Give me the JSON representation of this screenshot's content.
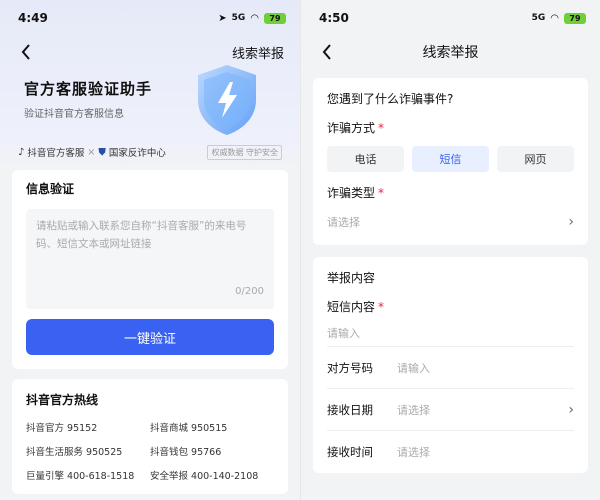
{
  "left": {
    "status": {
      "time": "4:49",
      "battery": "79",
      "signal": "5G"
    },
    "nav": {
      "right_label": "线索举报"
    },
    "hero": {
      "title": "官方客服验证助手",
      "subtitle": "验证抖音官方客服信息"
    },
    "trust": {
      "item1": "抖音官方客服",
      "sep": "×",
      "item2": "国家反诈中心",
      "tag": "权威数据 守护安全"
    },
    "verify": {
      "heading": "信息验证",
      "placeholder": "请粘贴或输入联系您自称“抖音客服”的来电号码、短信文本或网址链接",
      "counter": "0/200",
      "button": "一键验证"
    },
    "hotline": {
      "heading": "抖音官方热线",
      "items": [
        "抖音官方 95152",
        "抖音商城 950515",
        "抖音生活服务 950525",
        "抖音钱包 95766",
        "巨量引擎 400-618-1518",
        "安全举报 400-140-2108"
      ]
    }
  },
  "right": {
    "status": {
      "time": "4:50",
      "battery": "79",
      "signal": "5G"
    },
    "nav": {
      "title": "线索举报"
    },
    "question": "您遇到了什么诈骗事件?",
    "method": {
      "label": "诈骗方式",
      "required": "*",
      "options": [
        "电话",
        "短信",
        "网页"
      ],
      "selected": "短信"
    },
    "type": {
      "label": "诈骗类型",
      "required": "*",
      "placeholder": "请选择"
    },
    "report": {
      "heading": "举报内容",
      "sms_label": "短信内容",
      "sms_required": "*",
      "sms_placeholder": "请输入",
      "rows": [
        {
          "label": "对方号码",
          "placeholder": "请输入"
        },
        {
          "label": "接收日期",
          "placeholder": "请选择"
        },
        {
          "label": "接收时间",
          "placeholder": "请选择"
        }
      ]
    }
  },
  "colors": {
    "primary": "#3a62f2",
    "required": "#e24",
    "battery": "#6fcf3a"
  }
}
